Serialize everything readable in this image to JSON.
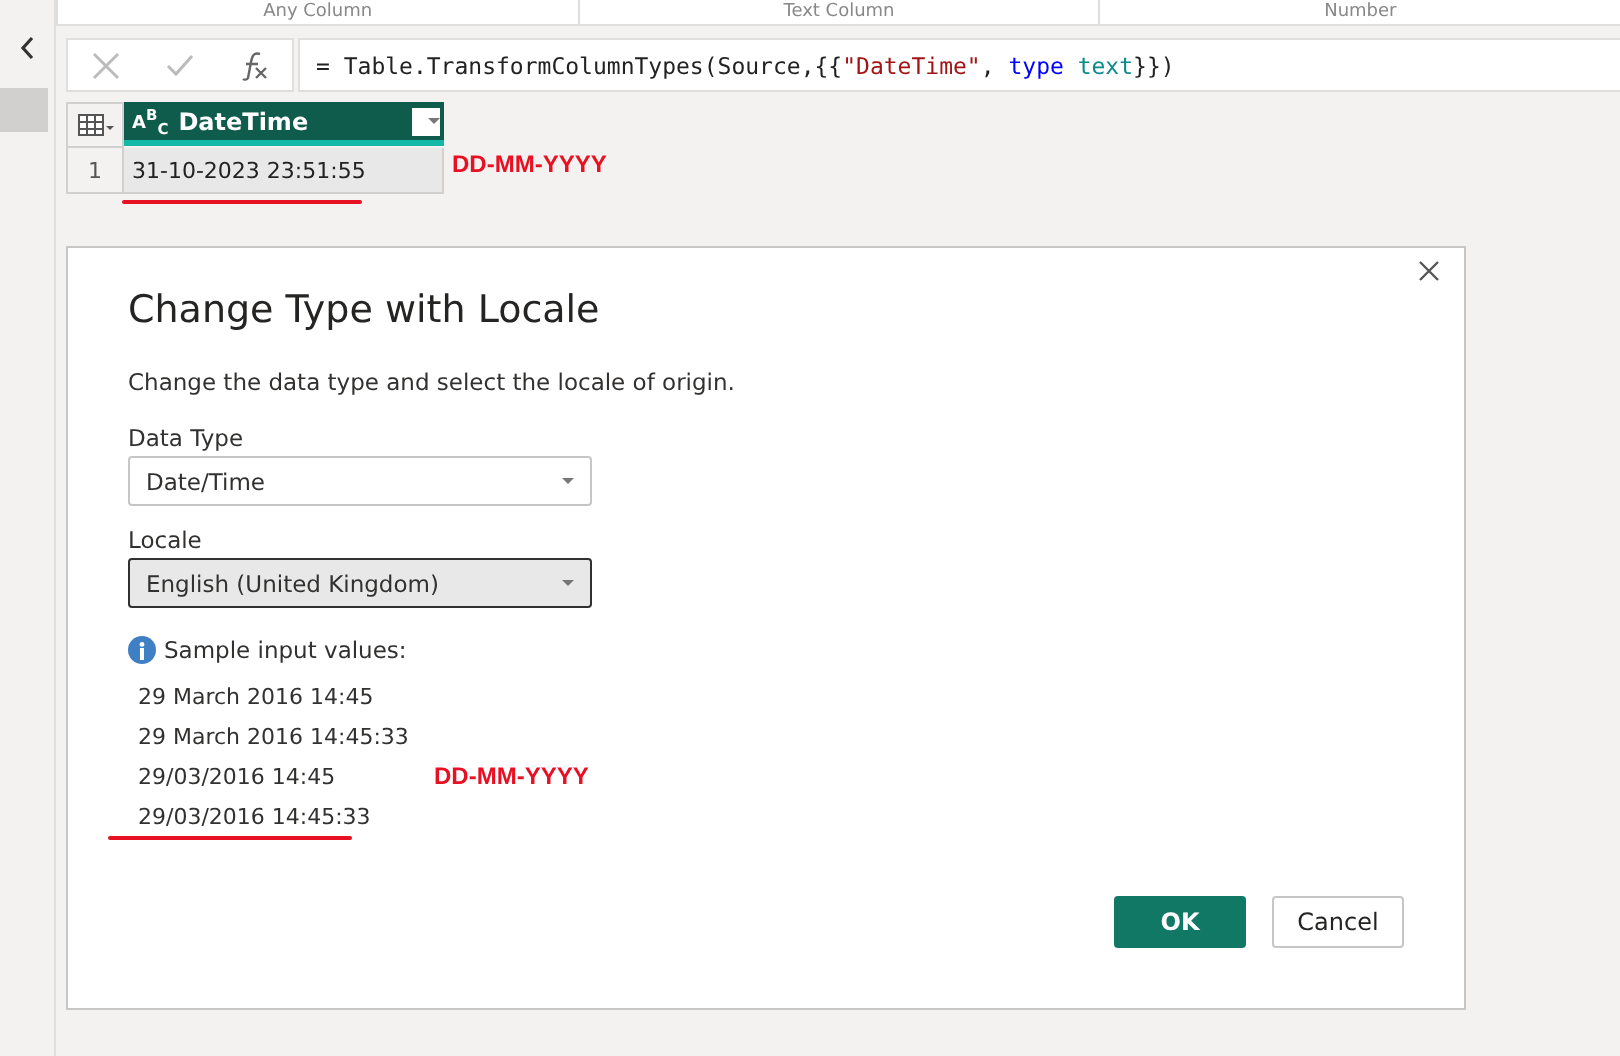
{
  "column_headers": [
    "Any Column",
    "Text Column",
    "Number"
  ],
  "formula_bar": {
    "tokens": [
      {
        "kind": "plain",
        "text": "= Table.TransformColumnTypes(Source,{{"
      },
      {
        "kind": "string",
        "text": "\"DateTime\""
      },
      {
        "kind": "plain",
        "text": ", "
      },
      {
        "kind": "keyword",
        "text": "type"
      },
      {
        "kind": "type",
        "text": "text"
      },
      {
        "kind": "plain",
        "text": "}})"
      }
    ]
  },
  "table": {
    "columns": [
      {
        "type_label": "A$^{B}$$_{C}$",
        "name": "DateTime"
      }
    ],
    "rows": [
      {
        "index": "1",
        "cells": [
          "31-10-2023 23:51:55"
        ]
      }
    ]
  },
  "table_annotation": "DD-MM-YYYY",
  "dialog": {
    "title": "Change Type with Locale",
    "description": "Change the data type and select the locale of origin.",
    "fields": [
      {
        "label": "Data Type",
        "value": "Date/Time",
        "focused": false
      },
      {
        "label": "Locale",
        "value": "English (United Kingdom)",
        "focused": true
      }
    ],
    "sample_heading": "Sample input values:",
    "samples": [
      {
        "text": "29 March 2016 14:45",
        "underlined": false
      },
      {
        "text": "29 March 2016 14:45:33",
        "underlined": false
      },
      {
        "text": "29/03/2016 14:45",
        "underlined": false,
        "annotation": "DD-MM-YYYY"
      },
      {
        "text": "29/03/2016 14:45:33",
        "underlined": true
      }
    ],
    "buttons": [
      {
        "label": "OK",
        "primary": true
      },
      {
        "label": "Cancel",
        "primary": false
      }
    ]
  }
}
